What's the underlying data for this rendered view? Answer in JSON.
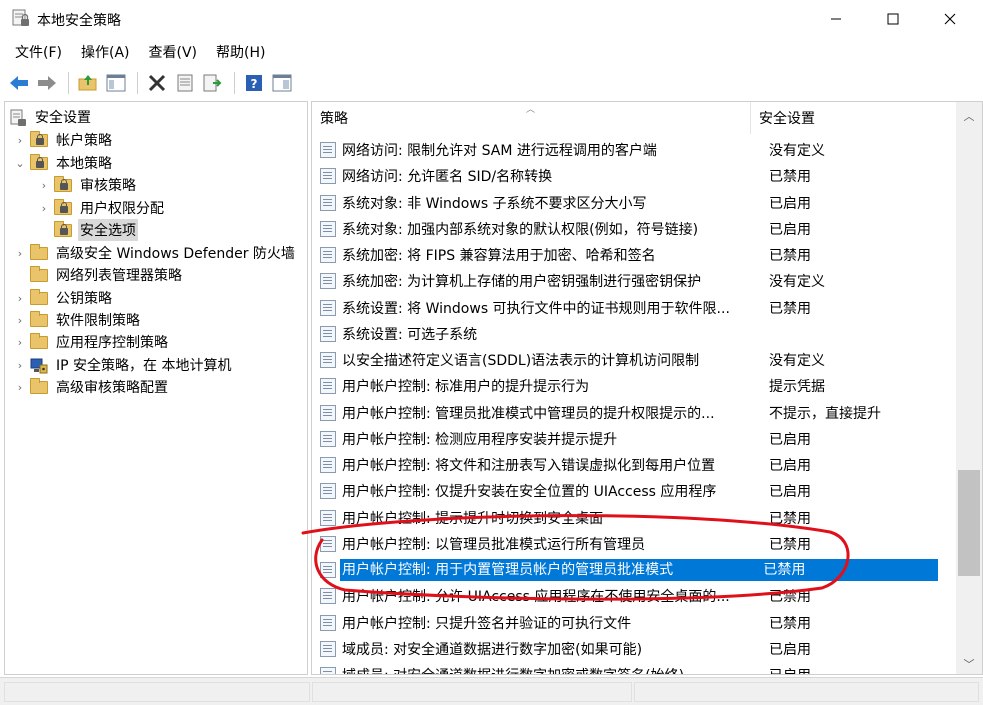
{
  "window": {
    "title": "本地安全策略",
    "min_icon": "minimize-icon",
    "max_icon": "maximize-icon",
    "close_icon": "close-icon"
  },
  "menu": [
    "文件(F)",
    "操作(A)",
    "查看(V)",
    "帮助(H)"
  ],
  "toolbar": [
    "back-arrow-icon",
    "forward-arrow-icon",
    "up-folder-icon",
    "show-hide-tree-icon",
    "delete-icon",
    "properties-icon",
    "export-list-icon",
    "help-icon",
    "mmc-view-icon"
  ],
  "tree": [
    {
      "label": "安全设置",
      "toggle": "",
      "icon": "security-settings-icon"
    },
    {
      "label": "帐户策略",
      "toggle": "›",
      "icon": "folder-lock-icon"
    },
    {
      "label": "本地策略",
      "toggle": "⌄",
      "icon": "folder-lock-icon"
    },
    {
      "label": "审核策略",
      "toggle": "›",
      "icon": "folder-lock-icon"
    },
    {
      "label": "用户权限分配",
      "toggle": "›",
      "icon": "folder-lock-icon"
    },
    {
      "label": "安全选项",
      "toggle": "",
      "icon": "folder-lock-icon",
      "selected": true
    },
    {
      "label": "高级安全 Windows Defender 防火墙",
      "toggle": "›",
      "icon": "folder-icon"
    },
    {
      "label": "网络列表管理器策略",
      "toggle": "",
      "icon": "folder-icon"
    },
    {
      "label": "公钥策略",
      "toggle": "›",
      "icon": "folder-icon"
    },
    {
      "label": "软件限制策略",
      "toggle": "›",
      "icon": "folder-icon"
    },
    {
      "label": "应用程序控制策略",
      "toggle": "›",
      "icon": "folder-icon"
    },
    {
      "label": "IP 安全策略，在 本地计算机",
      "toggle": "›",
      "icon": "ip-security-icon"
    },
    {
      "label": "高级审核策略配置",
      "toggle": "›",
      "icon": "folder-icon"
    }
  ],
  "list": {
    "columns": {
      "policy": "策略",
      "setting": "安全设置"
    },
    "rows": [
      {
        "policy": "网络访问: 限制允许对 SAM 进行远程调用的客户端",
        "setting": "没有定义"
      },
      {
        "policy": "网络访问: 允许匿名 SID/名称转换",
        "setting": "已禁用"
      },
      {
        "policy": "系统对象: 非 Windows 子系统不要求区分大小写",
        "setting": "已启用"
      },
      {
        "policy": "系统对象: 加强内部系统对象的默认权限(例如，符号链接)",
        "setting": "已启用"
      },
      {
        "policy": "系统加密: 将 FIPS 兼容算法用于加密、哈希和签名",
        "setting": "已禁用"
      },
      {
        "policy": "系统加密: 为计算机上存储的用户密钥强制进行强密钥保护",
        "setting": "没有定义"
      },
      {
        "policy": "系统设置: 将 Windows 可执行文件中的证书规则用于软件限...",
        "setting": "已禁用"
      },
      {
        "policy": "系统设置: 可选子系统",
        "setting": ""
      },
      {
        "policy": "以安全描述符定义语言(SDDL)语法表示的计算机访问限制",
        "setting": "没有定义"
      },
      {
        "policy": "用户帐户控制: 标准用户的提升提示行为",
        "setting": "提示凭据"
      },
      {
        "policy": "用户帐户控制: 管理员批准模式中管理员的提升权限提示的...",
        "setting": "不提示，直接提升"
      },
      {
        "policy": "用户帐户控制: 检测应用程序安装并提示提升",
        "setting": "已启用"
      },
      {
        "policy": "用户帐户控制: 将文件和注册表写入错误虚拟化到每用户位置",
        "setting": "已启用"
      },
      {
        "policy": "用户帐户控制: 仅提升安装在安全位置的 UIAccess 应用程序",
        "setting": "已启用"
      },
      {
        "policy": "用户帐户控制: 提示提升时切换到安全桌面",
        "setting": "已禁用"
      },
      {
        "policy": "用户帐户控制: 以管理员批准模式运行所有管理员",
        "setting": "已禁用"
      },
      {
        "policy": "用户帐户控制: 用于内置管理员帐户的管理员批准模式",
        "setting": "已禁用",
        "selected": true
      },
      {
        "policy": "用户帐户控制: 允许 UIAccess 应用程序在不使用安全桌面的...",
        "setting": "已禁用"
      },
      {
        "policy": "用户帐户控制: 只提升签名并验证的可执行文件",
        "setting": "已禁用"
      },
      {
        "policy": "域成员: 对安全通道数据进行数字加密(如果可能)",
        "setting": "已启用"
      },
      {
        "policy": "域成员: 对安全通道数据进行数字加密或数字签名(始终)",
        "setting": "已启用"
      }
    ]
  },
  "colors": {
    "selection": "#0078d7",
    "annotation": "#e0101a"
  }
}
